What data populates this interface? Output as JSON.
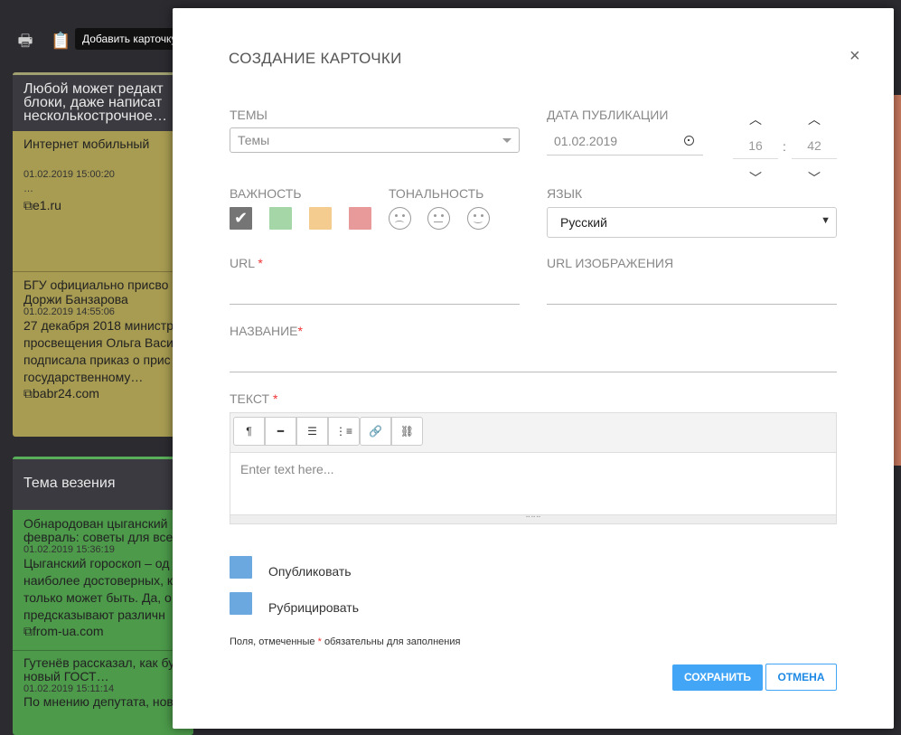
{
  "background": {
    "toolbar": {
      "print_icon": "printer-icon",
      "add_card_icon": "clipboard-add-icon",
      "tooltip": "Добавить карточку"
    },
    "column1": {
      "title_lines": [
        "Любой может редакт",
        "блоки, даже написат",
        "несколькострочное…"
      ],
      "cards": [
        {
          "title": "Интернет мобильный",
          "meta": "01.02.2019 15:00:20",
          "extra": "…",
          "source": "e1.ru"
        },
        {
          "title": "БГУ официально присво\nДоржи Банзарова",
          "meta": "01.02.2019 14:55:06",
          "text": "27 декабря 2018 министр\nпросвещения Ольга Васи\nподписала приказ о прис\nгосударственному…",
          "source": "babr24.com"
        }
      ]
    },
    "column2": {
      "title": "Тема везения",
      "cards": [
        {
          "title": "Обнародован цыганский\nфевраль: советы для все",
          "meta": "01.02.2019 15:36:19",
          "text": "Цыганский гороскоп – од\nнаиболее достоверных, к\nтолько может быть. Да, о\nпредсказывают различн",
          "source": "from-ua.com"
        },
        {
          "title": "Гутенёв рассказал, как бу\nновый ГОСТ…",
          "meta": "01.02.2019 15:11:14",
          "text": "По мнению депутата, нов"
        }
      ]
    }
  },
  "modal": {
    "title": "СОЗДАНИЕ КАРТОЧКИ",
    "close": "×",
    "topics_label": "ТЕМЫ",
    "topics_placeholder": "Темы",
    "pubdate_label": "ДАТА ПУБЛИКАЦИИ",
    "pubdate_value": "01.02.2019",
    "hour": "16",
    "minute": "42",
    "colon": ":",
    "importance_label": "ВАЖНОСТЬ",
    "tonality_label": "ТОНАЛЬНОСТЬ",
    "language_label": "ЯЗЫК",
    "language_value": "Русский",
    "url_label": "URL",
    "image_url_label": "URL ИЗОБРАЖЕНИЯ",
    "name_label": "НАЗВАНИЕ",
    "text_label": "ТЕКСТ",
    "required_mark": "*",
    "editor_placeholder": "Enter text here...",
    "editor_tools": [
      "¶",
      "━",
      "☰",
      "⋮≡",
      "🔗",
      "⛓"
    ],
    "publish_label": "Опубликовать",
    "rubricate_label": "Рубрицировать",
    "note_before": "Поля, отмеченные",
    "note_after": "обязательны для заполнения",
    "save": "СОХРАНИТЬ",
    "cancel": "ОТМЕНА"
  },
  "colors": {
    "importance": [
      "#757575",
      "#a5d6a7",
      "#f5cc8f",
      "#e89a9a"
    ],
    "checkbox": "#6ca8e0",
    "primary": "#42a5f5"
  }
}
